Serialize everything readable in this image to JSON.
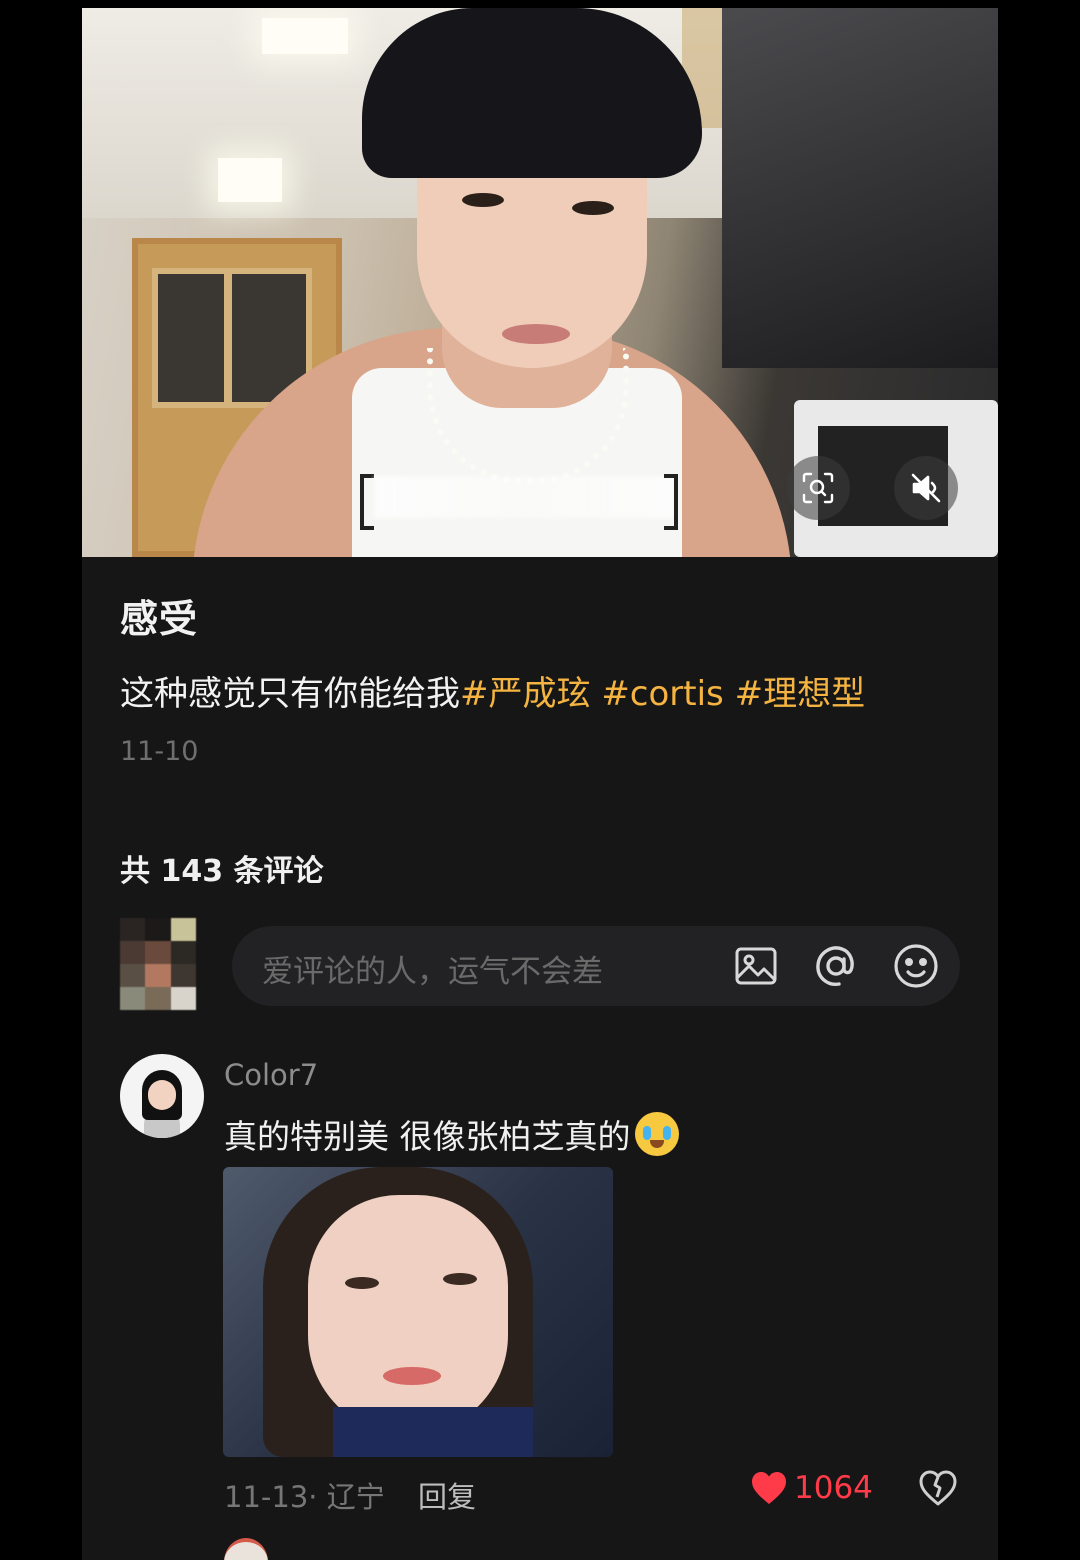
{
  "post": {
    "title": "感受",
    "desc_plain": "这种感觉只有你能给我",
    "tags": [
      "#严成玹",
      "#cortis",
      "#理想型"
    ],
    "date": "11-10"
  },
  "video": {
    "scan_icon": "scan-search-icon",
    "mute_icon": "volume-mute-icon"
  },
  "comments_header": {
    "count_label": "共 143 条评论"
  },
  "comment_input": {
    "placeholder": "爱评论的人，运气不会差",
    "icons": [
      "image-icon",
      "at-icon",
      "emoji-icon"
    ]
  },
  "comments": [
    {
      "user": "Color7",
      "text": "真的特别美 很像张柏芝真的",
      "emoji": "crying-laughing-emoji",
      "meta": "11-13· 辽宁",
      "reply_label": "回复",
      "likes": "1064"
    }
  ],
  "colors": {
    "background": "#161616",
    "tag": "#f5b441",
    "like": "#ff3b4a",
    "muted": "#6f6f6f"
  }
}
